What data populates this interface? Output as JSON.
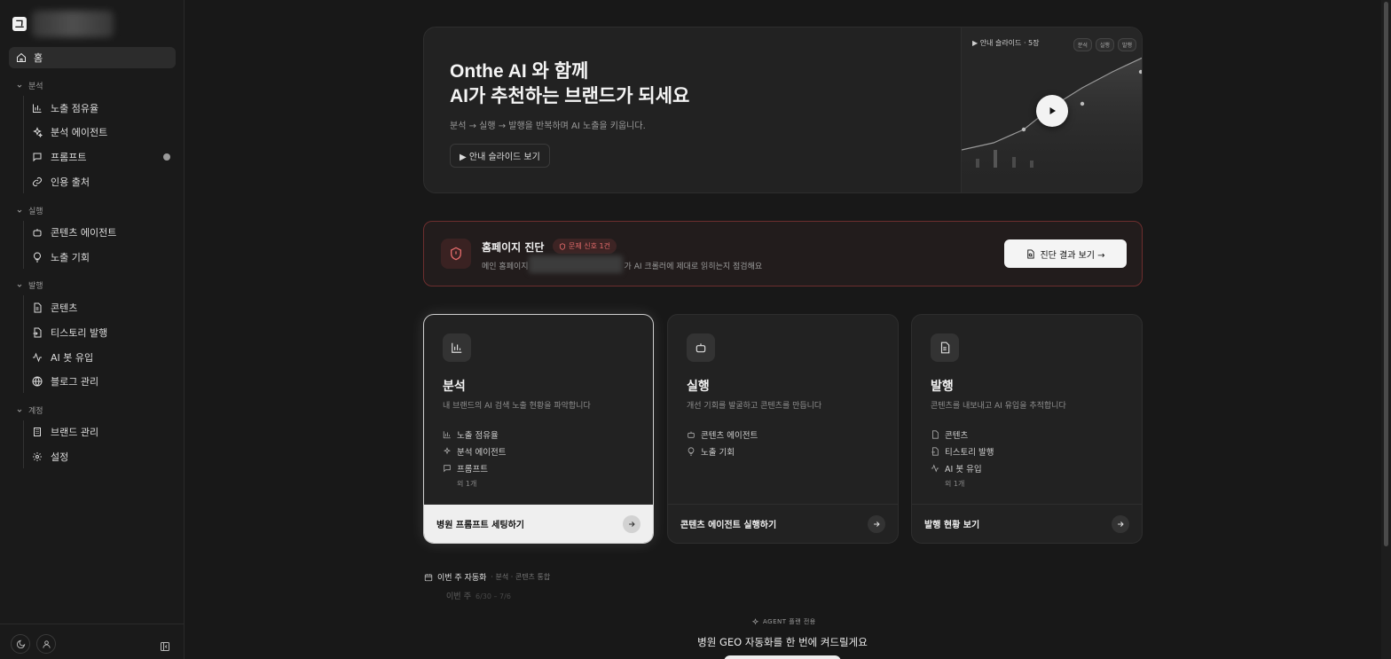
{
  "sidebar": {
    "logo_text": "그",
    "home_label": "홈",
    "groups": [
      {
        "label": "분석",
        "items": [
          {
            "label": "노출 점유율",
            "icon": "bar-chart-icon"
          },
          {
            "label": "분석 에이전트",
            "icon": "sparkles-icon"
          },
          {
            "label": "프롬프트",
            "icon": "message-icon"
          },
          {
            "label": "인용 출처",
            "icon": "link-icon"
          }
        ]
      },
      {
        "label": "실행",
        "items": [
          {
            "label": "콘텐츠 에이전트",
            "icon": "bot-icon"
          },
          {
            "label": "노출 기회",
            "icon": "lightbulb-icon"
          }
        ]
      },
      {
        "label": "발행",
        "items": [
          {
            "label": "콘텐츠",
            "icon": "file-icon"
          },
          {
            "label": "티스토리 발행",
            "icon": "file-export-icon"
          },
          {
            "label": "AI 봇 유입",
            "icon": "activity-icon"
          },
          {
            "label": "블로그 관리",
            "icon": "globe-icon"
          }
        ]
      },
      {
        "label": "계정",
        "items": [
          {
            "label": "브랜드 관리",
            "icon": "building-icon"
          },
          {
            "label": "설정",
            "icon": "gear-icon"
          }
        ]
      }
    ]
  },
  "hero": {
    "title_line1": "Onthe AI 와 함께",
    "title_line2": "AI가 추천하는 브랜드가 되세요",
    "subtitle": "분석 → 실행 → 발행을 반복하며 AI 노출을 키웁니다.",
    "button_label": "▶ 안내 슬라이드 보기",
    "preview_title": "▶ 안내 슬라이드 · 5장",
    "preview_tags": [
      "분석",
      "실행",
      "발행"
    ]
  },
  "diagnosis": {
    "title": "홈페이지 진단",
    "badge": "문제 신호 1건",
    "desc_left": "메인 홈페이지",
    "desc_right": "가 AI 크롤러에 제대로 읽히는지 점검해요",
    "button_label": "진단 결과 보기 →"
  },
  "cards": [
    {
      "title": "분석",
      "desc": "내 브랜드의 AI 검색 노출 현황을 파악합니다",
      "items": [
        "노출 점유율",
        "분석 에이전트",
        "프롬프트"
      ],
      "more": "외 1개",
      "footer": "병원 프롬프트 세팅하기"
    },
    {
      "title": "실행",
      "desc": "개선 기회를 발굴하고 콘텐츠를 만듭니다",
      "items": [
        "콘텐츠 에이전트",
        "노출 기회"
      ],
      "more": "",
      "footer": "콘텐츠 에이전트 실행하기"
    },
    {
      "title": "발행",
      "desc": "콘텐츠를 내보내고 AI 유입을 추적합니다",
      "items": [
        "콘텐츠",
        "티스토리 발행",
        "AI 봇 유입"
      ],
      "more": "외 1개",
      "footer": "발행 현황 보기"
    }
  ],
  "weekly": {
    "title": "이번 주 자동화",
    "subtitle": "· 분석 · 콘텐츠 통합",
    "faded_title": "이번 주",
    "faded_range": "6/30 – 7/6"
  },
  "agent": {
    "tag": "AGENT 플랜 전용",
    "title": "병원 GEO 자동화를 한 번에 켜드릴게요"
  }
}
